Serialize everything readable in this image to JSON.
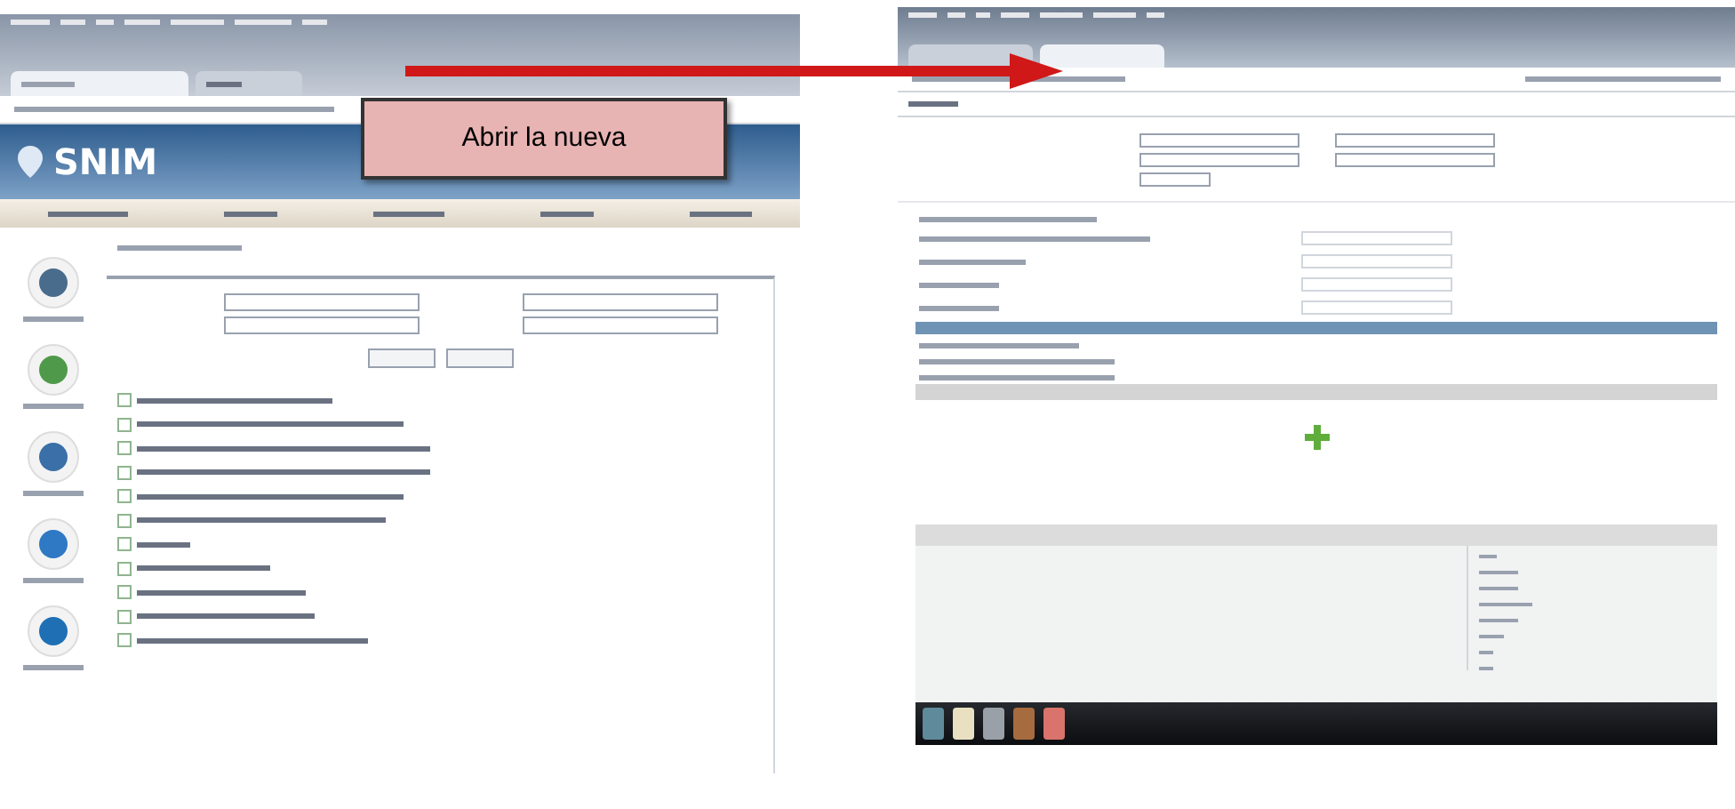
{
  "left_screen": {
    "logo": "SNIM"
  },
  "callout": {
    "text": "Abrir la nueva"
  }
}
